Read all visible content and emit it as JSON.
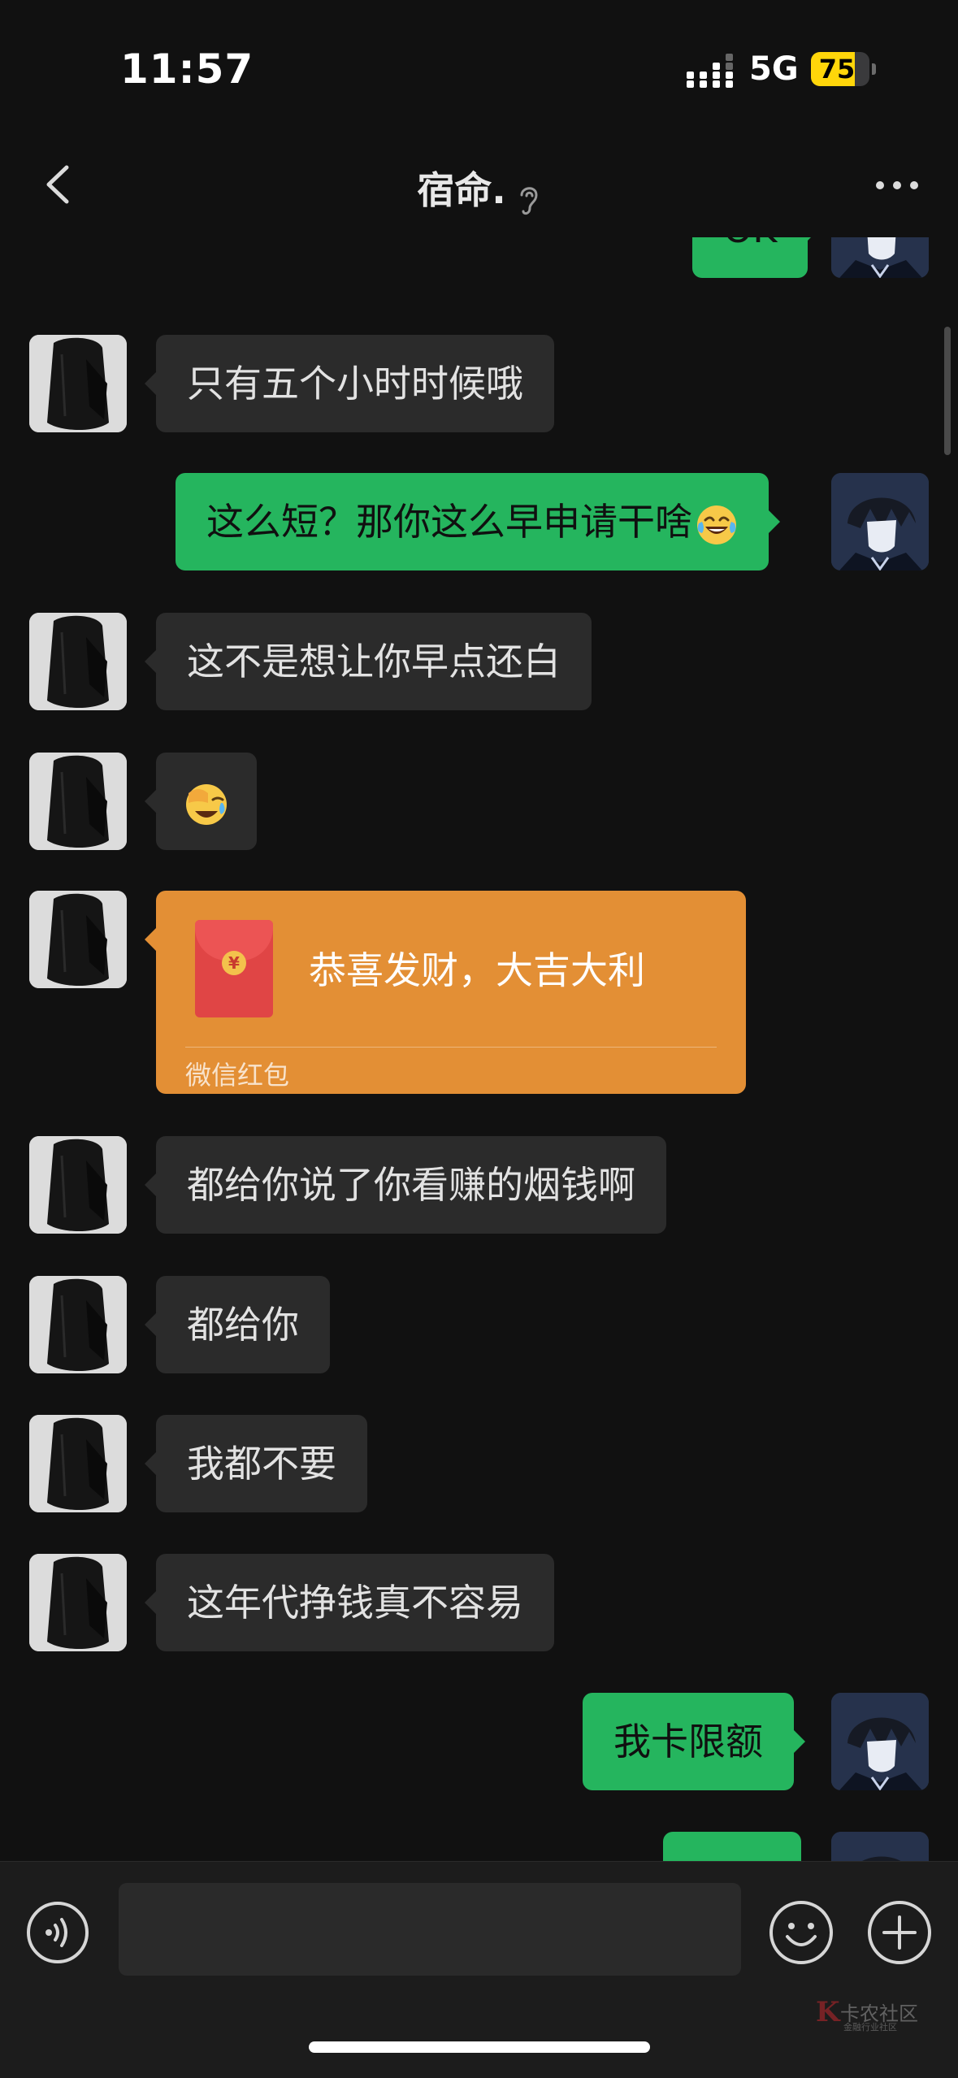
{
  "status": {
    "time": "11:57",
    "network": "5G",
    "battery": "75",
    "battery_level": 0.75,
    "battery_color": "#ffd60a"
  },
  "nav": {
    "title": "宿命."
  },
  "messages": [
    {
      "text": "OK"
    },
    {
      "text": "只有五个小时时候哦"
    },
    {
      "text": "这么短？那你这么早申请干啥",
      "emoji": "tears-of-joy"
    },
    {
      "text": "这不是想让你早点还白"
    },
    {
      "emoji": "loudly-laughing"
    },
    {
      "packet_text": "恭喜发财，大吉大利",
      "packet_label": "微信红包",
      "packet_color": "#e38f35"
    },
    {
      "text": "都给你说了你看赚的烟钱啊"
    },
    {
      "text": "都给你"
    },
    {
      "text": "我都不要"
    },
    {
      "text": "这年代挣钱真不容易"
    },
    {
      "text": "我卡限额"
    }
  ],
  "colors": {
    "background": "#111111",
    "incoming_bubble": "#2b2b2b",
    "outgoing_bubble": "#25b55e"
  },
  "input": {
    "value": ""
  },
  "watermark": {
    "logo": "K",
    "name": "卡农社区",
    "tagline": "金融行业社区"
  }
}
